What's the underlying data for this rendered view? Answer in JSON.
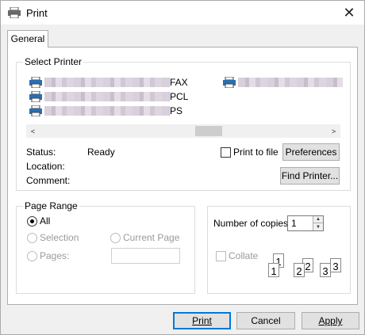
{
  "window": {
    "title": "Print",
    "icon": "printer-icon",
    "close_icon": "close-icon"
  },
  "tabs": [
    {
      "label": "General",
      "active": true
    }
  ],
  "select_printer": {
    "label": "Select Printer",
    "printers": [
      {
        "suffix": "FAX",
        "icon": "printer-icon",
        "name_obscured": true
      },
      {
        "suffix": "PCL",
        "icon": "printer-icon",
        "name_obscured": true
      },
      {
        "suffix": "PS",
        "icon": "printer-icon",
        "name_obscured": true
      },
      {
        "suffix": "",
        "icon": "printer-icon",
        "name_obscured": true
      }
    ],
    "scroll_left": "<",
    "scroll_right": ">"
  },
  "status": {
    "status_label": "Status:",
    "status_value": "Ready",
    "location_label": "Location:",
    "location_value": "",
    "comment_label": "Comment:",
    "comment_value": ""
  },
  "print_to_file": {
    "label": "Print to file",
    "checked": false
  },
  "buttons": {
    "preferences": "Preferences",
    "find_printer": "Find Printer...",
    "print": "Print",
    "cancel": "Cancel",
    "apply": "Apply"
  },
  "page_range": {
    "label": "Page Range",
    "options": {
      "all": "All",
      "selection": "Selection",
      "current_page": "Current Page",
      "pages": "Pages:"
    },
    "selected": "all",
    "pages_value": ""
  },
  "copies": {
    "label": "Number of copies:",
    "value": "1",
    "collate_label": "Collate",
    "collate_checked": false,
    "collate_enabled": false,
    "collate_pages": [
      "1",
      "1",
      "2",
      "2",
      "3",
      "3"
    ]
  },
  "colors": {
    "accent": "#0078d7",
    "disabled_text": "#9a9a9a"
  }
}
